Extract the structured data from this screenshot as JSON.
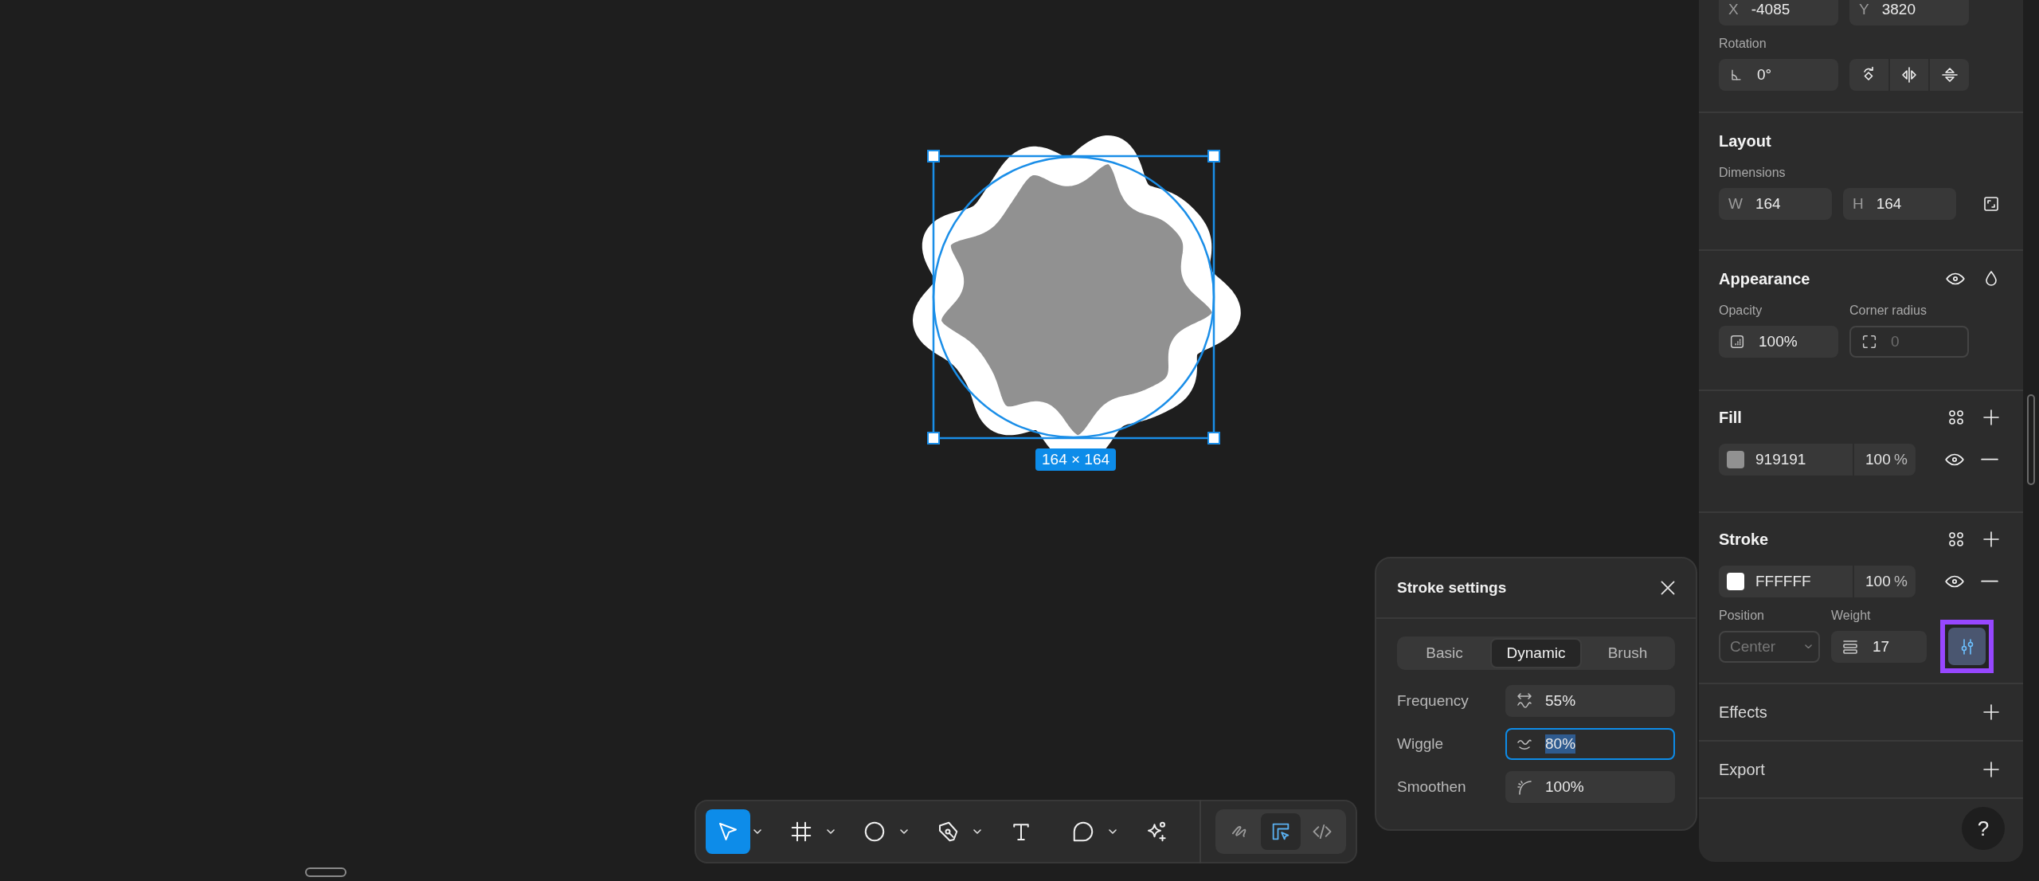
{
  "canvas": {
    "selection_size": "164 × 164"
  },
  "properties": {
    "position": {
      "x": {
        "label": "X",
        "value": "-4085"
      },
      "y": {
        "label": "Y",
        "value": "3820"
      }
    },
    "rotation": {
      "label": "Rotation",
      "value": "0°"
    },
    "layout": {
      "title": "Layout",
      "dimensions_label": "Dimensions",
      "w": {
        "label": "W",
        "value": "164"
      },
      "h": {
        "label": "H",
        "value": "164"
      }
    },
    "appearance": {
      "title": "Appearance",
      "opacity_label": "Opacity",
      "opacity": "100%",
      "corner_radius_label": "Corner radius",
      "corner_radius_placeholder": "0"
    },
    "fill": {
      "title": "Fill",
      "items": [
        {
          "hex": "919191",
          "opacity": "100",
          "unit": "%"
        }
      ]
    },
    "stroke": {
      "title": "Stroke",
      "items": [
        {
          "hex": "FFFFFF",
          "opacity": "100",
          "unit": "%"
        }
      ],
      "position_label": "Position",
      "position": "Center",
      "position_disabled": true,
      "weight_label": "Weight",
      "weight": "17",
      "settings_highlighted": true
    },
    "effects": {
      "title": "Effects"
    },
    "export": {
      "title": "Export"
    }
  },
  "help": "?",
  "stroke_settings": {
    "title": "Stroke settings",
    "tabs": [
      {
        "label": "Basic",
        "selected": false
      },
      {
        "label": "Dynamic",
        "selected": true
      },
      {
        "label": "Brush",
        "selected": false
      }
    ],
    "rows": [
      {
        "kind": "frequency",
        "label": "Frequency",
        "value": "55%",
        "focused": false
      },
      {
        "kind": "wiggle",
        "label": "Wiggle",
        "value": "80%",
        "focused": true
      },
      {
        "kind": "smoothen",
        "label": "Smoothen",
        "value": "100%",
        "focused": false
      }
    ]
  },
  "toolbar": {
    "tools": [
      {
        "kind": "pointer",
        "selected": true,
        "dropdown": true
      },
      {
        "kind": "frame",
        "selected": false,
        "dropdown": true
      },
      {
        "kind": "ellipse",
        "selected": false,
        "dropdown": true
      },
      {
        "kind": "pen",
        "selected": false,
        "dropdown": true
      },
      {
        "kind": "text",
        "selected": false,
        "dropdown": false
      },
      {
        "kind": "comment",
        "selected": false,
        "dropdown": true
      },
      {
        "kind": "ai",
        "selected": false,
        "dropdown": false
      }
    ],
    "modes": [
      {
        "kind": "draw",
        "selected": false
      },
      {
        "kind": "design",
        "selected": true
      },
      {
        "kind": "code",
        "selected": false
      }
    ]
  }
}
